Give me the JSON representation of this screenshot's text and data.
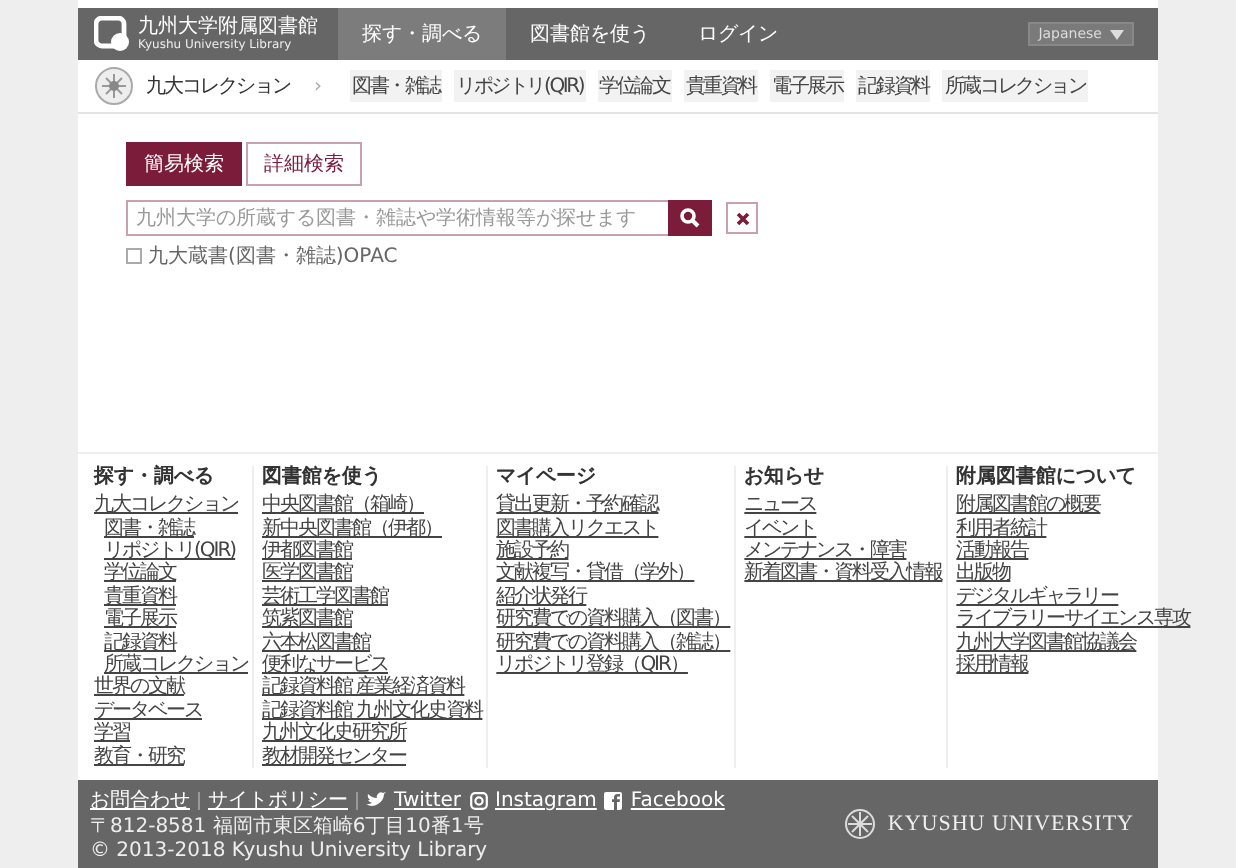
{
  "header": {
    "logo_title": "九州大学附属図書館",
    "logo_subtitle": "Kyushu University Library",
    "nav": [
      {
        "label": "探す・調べる",
        "selected": true
      },
      {
        "label": "図書館を使う",
        "selected": false
      },
      {
        "label": "ログイン",
        "selected": false
      }
    ],
    "language": "Japanese"
  },
  "subnav": {
    "title": "九大コレクション",
    "separator": "›",
    "items": [
      "図書・雑誌",
      "リポジトリ(QIR)",
      "学位論文",
      "貴重資料",
      "電子展示",
      "記録資料",
      "所蔵コレクション"
    ]
  },
  "search": {
    "tabs": [
      {
        "label": "簡易検索",
        "selected": true
      },
      {
        "label": "詳細検索",
        "selected": false
      }
    ],
    "placeholder": "九州大学の所蔵する図書・雑誌や学術情報等が探せます",
    "option": {
      "label": "九大蔵書(図書・雑誌)OPAC",
      "checked": false
    }
  },
  "footer_columns": [
    {
      "heading": "探す・調べる",
      "links": [
        {
          "label": "九大コレクション",
          "children": [
            {
              "label": "図書・雑誌"
            },
            {
              "label": "リポジトリ(QIR)"
            },
            {
              "label": "学位論文"
            },
            {
              "label": "貴重資料"
            },
            {
              "label": "電子展示"
            },
            {
              "label": "記録資料"
            },
            {
              "label": "所蔵コレクション"
            }
          ]
        },
        {
          "label": "世界の文献"
        },
        {
          "label": "データベース"
        },
        {
          "label": "学習"
        },
        {
          "label": "教育・研究"
        }
      ]
    },
    {
      "heading": "図書館を使う",
      "links": [
        {
          "label": "中央図書館（箱崎）"
        },
        {
          "label": "新中央図書館（伊都）"
        },
        {
          "label": "伊都図書館"
        },
        {
          "label": "医学図書館"
        },
        {
          "label": "芸術工学図書館"
        },
        {
          "label": "筑紫図書館"
        },
        {
          "label": "六本松図書館"
        },
        {
          "label": "便利なサービス"
        },
        {
          "label": "記録資料館 産業経済資料"
        },
        {
          "label": "記録資料館 九州文化史資料"
        },
        {
          "label": "九州文化史研究所"
        },
        {
          "label": "教材開発センター"
        }
      ]
    },
    {
      "heading": "マイページ",
      "links": [
        {
          "label": "貸出更新・予約確認"
        },
        {
          "label": "図書購入リクエスト"
        },
        {
          "label": "施設予約"
        },
        {
          "label": "文献複写・貸借（学外）"
        },
        {
          "label": "紹介状発行"
        },
        {
          "label": "研究費での資料購入（図書）"
        },
        {
          "label": "研究費での資料購入（雑誌）"
        },
        {
          "label": "リポジトリ登録（QIR）"
        }
      ]
    },
    {
      "heading": "お知らせ",
      "links": [
        {
          "label": "ニュース"
        },
        {
          "label": "イベント"
        },
        {
          "label": "メンテナンス・障害"
        },
        {
          "label": "新着図書・資料受入情報"
        }
      ]
    },
    {
      "heading": "附属図書館について",
      "links": [
        {
          "label": "附属図書館の概要"
        },
        {
          "label": "利用者統計"
        },
        {
          "label": "活動報告"
        },
        {
          "label": "出版物"
        },
        {
          "label": "デジタルギャラリー"
        },
        {
          "label": "ライブラリーサイエンス専攻"
        },
        {
          "label": "九州大学図書館協議会"
        },
        {
          "label": "採用情報"
        }
      ]
    }
  ],
  "bottom_bar": {
    "links": [
      {
        "kind": "text",
        "label": "お問合わせ"
      },
      {
        "kind": "text",
        "label": "サイトポリシー"
      },
      {
        "kind": "twitter",
        "label": "Twitter"
      },
      {
        "kind": "instagram",
        "label": "Instagram"
      },
      {
        "kind": "facebook",
        "label": "Facebook"
      }
    ],
    "address": "〒812-8581 福岡市東区箱崎6丁目10番1号",
    "copyright": "© 2013-2018 Kyushu University Library",
    "university": "KYUSHU UNIVERSITY"
  }
}
